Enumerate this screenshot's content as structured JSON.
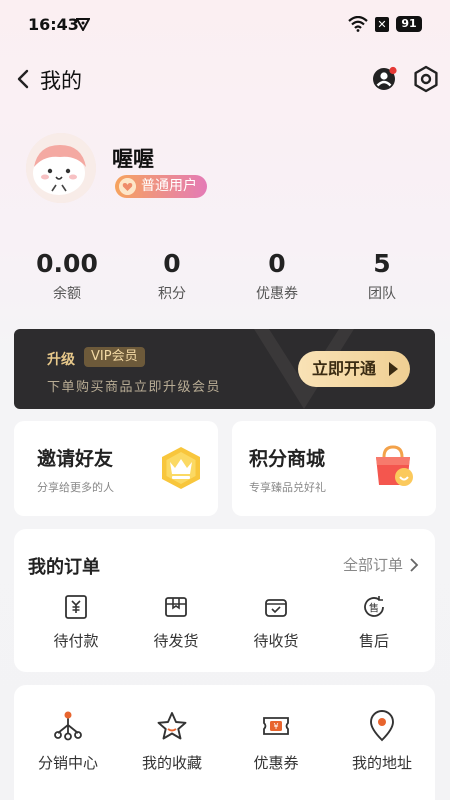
{
  "status": {
    "time": "16:43",
    "battery": "91"
  },
  "header": {
    "title": "我的"
  },
  "profile": {
    "name": "喔喔",
    "badge": "普通用户"
  },
  "stats": [
    {
      "value": "0.00",
      "label": "余额"
    },
    {
      "value": "0",
      "label": "积分"
    },
    {
      "value": "0",
      "label": "优惠券"
    },
    {
      "value": "5",
      "label": "团队"
    }
  ],
  "vip": {
    "upgrade": "升级",
    "tag": "VIP会员",
    "desc": "下单购买商品立即升级会员",
    "button": "立即开通"
  },
  "promos": [
    {
      "title": "邀请好友",
      "sub": "分享给更多的人"
    },
    {
      "title": "积分商城",
      "sub": "专享臻品兑好礼"
    }
  ],
  "orders": {
    "title": "我的订单",
    "all": "全部订单",
    "items": [
      {
        "label": "待付款",
        "icon": "payment-icon"
      },
      {
        "label": "待发货",
        "icon": "package-icon"
      },
      {
        "label": "待收货",
        "icon": "receive-icon"
      },
      {
        "label": "售后",
        "icon": "after-sale-icon"
      }
    ]
  },
  "tools": {
    "items": [
      {
        "label": "分销中心",
        "icon": "distribution-icon"
      },
      {
        "label": "我的收藏",
        "icon": "star-icon"
      },
      {
        "label": "优惠券",
        "icon": "coupon-icon"
      },
      {
        "label": "我的地址",
        "icon": "location-icon"
      }
    ]
  },
  "colors": {
    "vip_bg": "#2d2c2e",
    "vip_gold": "#efcf93",
    "badge_start": "#f6a35e",
    "badge_end": "#e47bb6",
    "notify_dot": "#e53935"
  }
}
